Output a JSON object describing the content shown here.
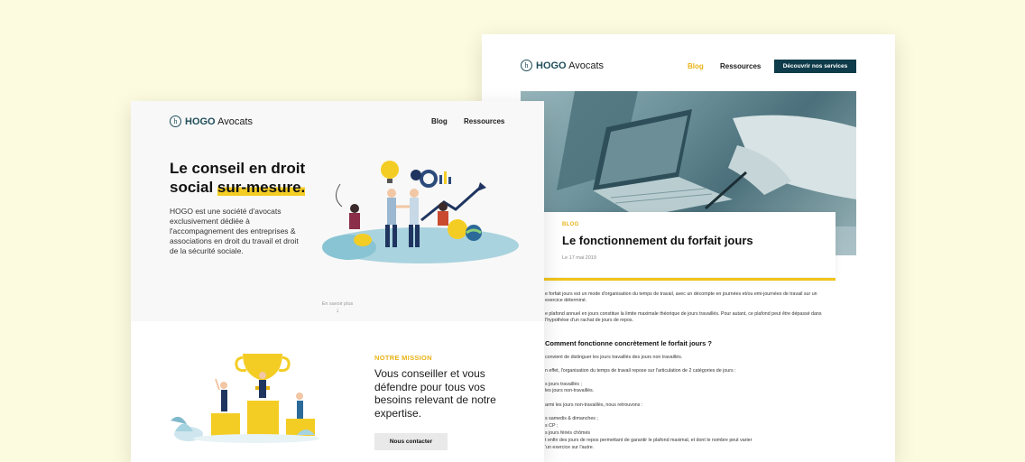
{
  "back": {
    "logo": {
      "brand": "HOGO",
      "suffix": "Avocats",
      "mark": "h"
    },
    "nav": {
      "blog": "Blog",
      "resources": "Ressources",
      "cta": "Découvrir nos services"
    },
    "article": {
      "tag": "BLOG",
      "title": "Le fonctionnement du forfait jours",
      "date": "Le 17 mai 2019"
    },
    "body": {
      "p1": "e forfait jours est un mode d'organisation du temps de travail, avec un décompte en journées et/ou emi-journées de travail sur un exercice déterminé.",
      "p2": "e plafond annuel en jours constitue la limite maximale théorique de jours travaillés. Pour autant, ce plafond peut être dépassé dans l'hypothèse d'un rachat de jours de repos.",
      "heading": "Comment fonctionne concrètement le forfait jours ?",
      "p3": "convient de distinguer les jours travaillés des jours non travaillés.",
      "p4": "n effet, l'organisation du temps de travail repose sur l'articulation de 2 catégories de jours :",
      "list1a": "s jours travaillés ;",
      "list1b": "les jours non-travaillés.",
      "p5": "armi les jours non-travaillés, nous retrouvons :",
      "list2a": "s samedis & dimanches ;",
      "list2b": "s CP ;",
      "list2c": "s jours fériés chômés",
      "list2d": "t enfin des jours de repos permettant de garantir le plafond maximal, et dont le nombre peut varier",
      "list2e": "'un exercice sur l'autre."
    }
  },
  "front": {
    "logo": {
      "brand": "HOGO",
      "suffix": "Avocats",
      "mark": "h"
    },
    "nav": {
      "blog": "Blog",
      "resources": "Ressources"
    },
    "hero": {
      "title_part1": "Le conseil en droit social ",
      "title_highlight": "sur-mesure.",
      "description": "HOGO est une société d'avocats exclusivement dédiée à l'accompagnement des entreprises & associations en droit du travail et droit de la sécurité sociale.",
      "scroll_label": "En savoir plus"
    },
    "mission": {
      "kicker": "NOTRE MISSION",
      "text": "Vous conseiller et vous défendre pour tous vos besoins relevant de notre expertise.",
      "button": "Nous contacter"
    }
  },
  "colors": {
    "background": "#fcfbdf",
    "brand": "#1f4e5a",
    "accent": "#f0c419",
    "cta": "#0f3c4a"
  }
}
